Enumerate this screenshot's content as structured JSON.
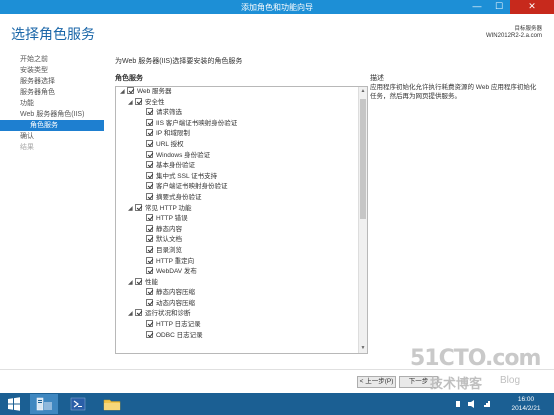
{
  "window": {
    "title": "添加角色和功能向导",
    "min": "—",
    "max": "☐",
    "close": "✕"
  },
  "header": {
    "title": "选择角色服务",
    "server_label": "目标服务器",
    "server_name": "WIN2012R2-2.a.com"
  },
  "nav": [
    {
      "label": "开始之前",
      "state": "normal"
    },
    {
      "label": "安装类型",
      "state": "normal"
    },
    {
      "label": "服务器选择",
      "state": "normal"
    },
    {
      "label": "服务器角色",
      "state": "normal"
    },
    {
      "label": "功能",
      "state": "normal"
    },
    {
      "label": "Web 服务器角色(IIS)",
      "state": "normal"
    },
    {
      "label": "角色服务",
      "state": "active"
    },
    {
      "label": "确认",
      "state": "normal"
    },
    {
      "label": "结果",
      "state": "disabled"
    }
  ],
  "main": {
    "instruction": "为Web 服务器(IIS)选择要安装的角色服务",
    "roles_heading": "角色服务",
    "description_heading": "描述",
    "description_text": "应用程序初始化允许执行耗费资源的 Web 应用程序初始化任务，然后再为网页提供服务。"
  },
  "tree": [
    {
      "level": 1,
      "expand": "◢",
      "label": "Web 服务器"
    },
    {
      "level": 2,
      "expand": "◢",
      "label": "安全性"
    },
    {
      "level": 3,
      "expand": "",
      "label": "请求筛选"
    },
    {
      "level": 3,
      "expand": "",
      "label": "IIS 客户端证书映射身份验证"
    },
    {
      "level": 3,
      "expand": "",
      "label": "IP 和域限制"
    },
    {
      "level": 3,
      "expand": "",
      "label": "URL 授权"
    },
    {
      "level": 3,
      "expand": "",
      "label": "Windows 身份验证"
    },
    {
      "level": 3,
      "expand": "",
      "label": "基本身份验证"
    },
    {
      "level": 3,
      "expand": "",
      "label": "集中式 SSL 证书支持"
    },
    {
      "level": 3,
      "expand": "",
      "label": "客户端证书映射身份验证"
    },
    {
      "level": 3,
      "expand": "",
      "label": "摘要式身份验证"
    },
    {
      "level": 2,
      "expand": "◢",
      "label": "常见 HTTP 功能"
    },
    {
      "level": 3,
      "expand": "",
      "label": "HTTP 错误"
    },
    {
      "level": 3,
      "expand": "",
      "label": "静态内容"
    },
    {
      "level": 3,
      "expand": "",
      "label": "默认文档"
    },
    {
      "level": 3,
      "expand": "",
      "label": "目录浏览"
    },
    {
      "level": 3,
      "expand": "",
      "label": "HTTP 重定向"
    },
    {
      "level": 3,
      "expand": "",
      "label": "WebDAV 发布"
    },
    {
      "level": 2,
      "expand": "◢",
      "label": "性能"
    },
    {
      "level": 3,
      "expand": "",
      "label": "静态内容压缩"
    },
    {
      "level": 3,
      "expand": "",
      "label": "动态内容压缩"
    },
    {
      "level": 2,
      "expand": "◢",
      "label": "运行状况和诊断"
    },
    {
      "level": 3,
      "expand": "",
      "label": "HTTP 日志记录"
    },
    {
      "level": 3,
      "expand": "",
      "label": "ODBC 日志记录"
    }
  ],
  "scroll": {
    "up": "▲",
    "down": "▼"
  },
  "buttons": {
    "prev": "< 上一步(P)",
    "next": "下一步"
  },
  "watermark": {
    "main": "51CTO.com",
    "sub": "技术博客",
    "blog": "Blog"
  },
  "taskbar": {
    "clock_time": "16:00",
    "clock_date": "2014/2/21"
  },
  "colors": {
    "titlebar": "#1d8fd6",
    "nav_active": "#1e7fd0",
    "header_title": "#1a66a8",
    "taskbar": "#1b5f93"
  }
}
